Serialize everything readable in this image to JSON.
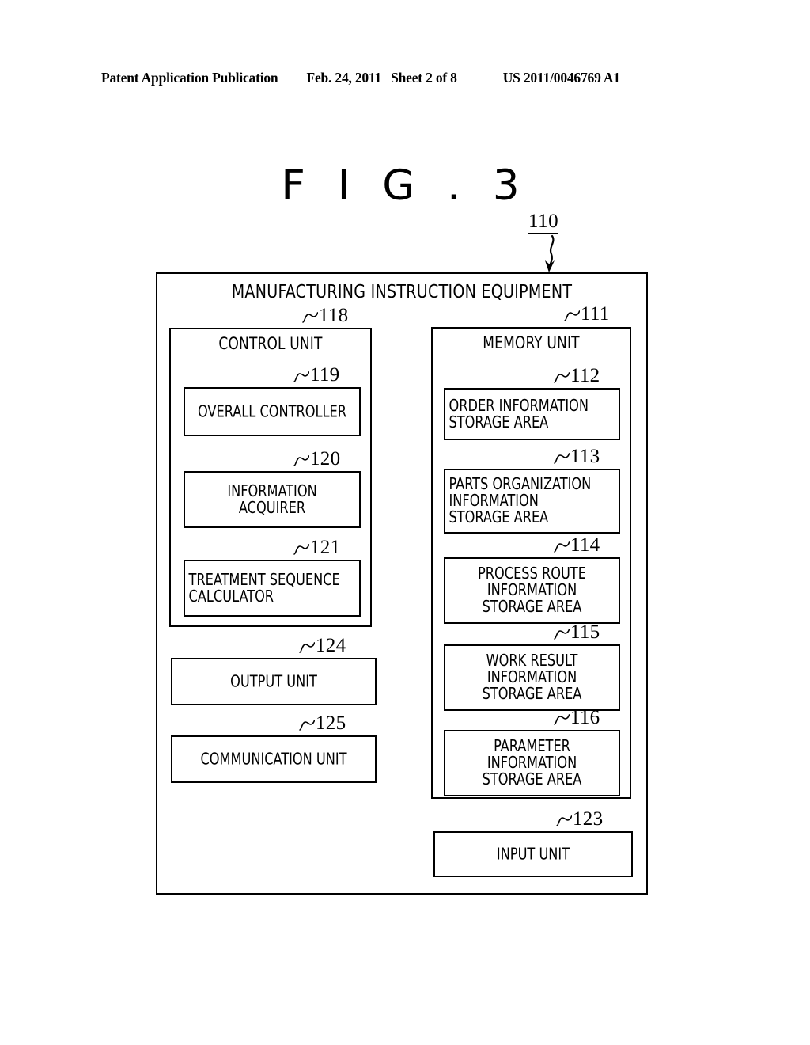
{
  "page_header": {
    "publication": "Patent Application Publication",
    "date": "Feb. 24, 2011",
    "sheet": "Sheet 2 of 8",
    "doc_number": "US 2011/0046769 A1"
  },
  "figure": {
    "title": "F I G . 3",
    "top_reference": "110"
  },
  "diagram": {
    "frame": {
      "ref": "110",
      "title": "MANUFACTURING INSTRUCTION EQUIPMENT"
    },
    "control_unit": {
      "ref": "118",
      "title": "CONTROL UNIT",
      "children": [
        {
          "ref": "119",
          "label": "OVERALL CONTROLLER",
          "align": "center"
        },
        {
          "ref": "120",
          "label": "INFORMATION\nACQUIRER",
          "align": "center"
        },
        {
          "ref": "121",
          "label": "TREATMENT SEQUENCE\nCALCULATOR",
          "align": "left"
        }
      ]
    },
    "memory_unit": {
      "ref": "111",
      "title": "MEMORY UNIT",
      "children": [
        {
          "ref": "112",
          "label": "ORDER INFORMATION\nSTORAGE AREA",
          "align": "left"
        },
        {
          "ref": "113",
          "label": "PARTS ORGANIZATION\nINFORMATION\nSTORAGE AREA",
          "align": "left"
        },
        {
          "ref": "114",
          "label": "PROCESS ROUTE\nINFORMATION\nSTORAGE AREA",
          "align": "center"
        },
        {
          "ref": "115",
          "label": "WORK RESULT\nINFORMATION\nSTORAGE AREA",
          "align": "center"
        },
        {
          "ref": "116",
          "label": "PARAMETER\nINFORMATION\nSTORAGE AREA",
          "align": "center"
        }
      ]
    },
    "standalone_blocks": [
      {
        "ref": "124",
        "label": "OUTPUT UNIT",
        "align": "center"
      },
      {
        "ref": "125",
        "label": "COMMUNICATION UNIT",
        "align": "center"
      },
      {
        "ref": "123",
        "label": "INPUT UNIT",
        "align": "center"
      }
    ]
  }
}
